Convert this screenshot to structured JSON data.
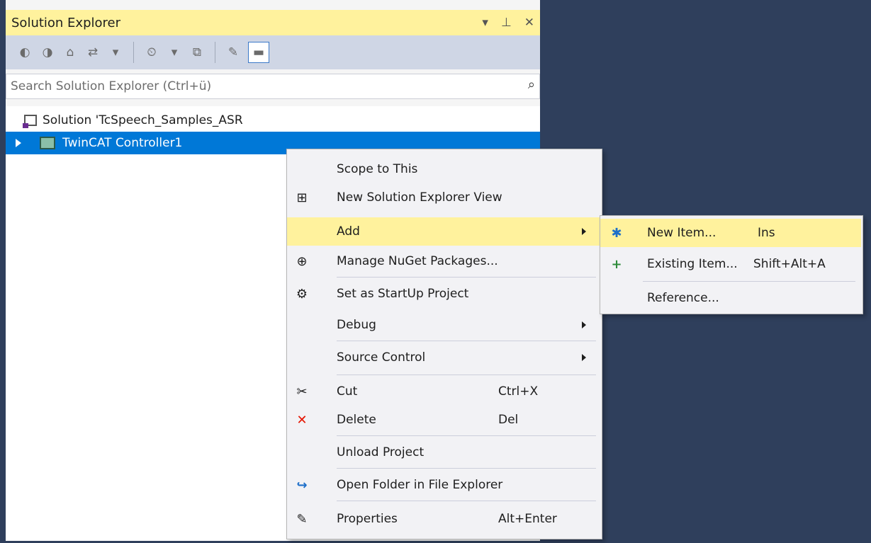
{
  "panel": {
    "title": "Solution Explorer",
    "title_icons": {
      "dropdown": "▾",
      "pin": "⊥",
      "close": "✕"
    }
  },
  "toolbar": {
    "back_icon": "◐",
    "forward_icon": "◑",
    "home_icon": "⌂",
    "sync_icon": "⇄",
    "pending_icon": "⏲",
    "collapse_icon": "⧉",
    "properties_icon": "✎",
    "preview_icon": "▬"
  },
  "search": {
    "placeholder": "Search Solution Explorer (Ctrl+ü)",
    "icon": "⌕"
  },
  "tree": {
    "solution_label": "Solution 'TcSpeech_Samples_ASR",
    "project_label": "TwinCAT Controller1"
  },
  "context_menu": {
    "items": [
      {
        "label": "Scope to This",
        "icon": "",
        "shortcut": ""
      },
      {
        "label": "New Solution Explorer View",
        "icon": "⊞",
        "shortcut": ""
      },
      {
        "label": "Add",
        "icon": "",
        "shortcut": ""
      },
      {
        "label": "Manage NuGet Packages...",
        "icon": "⊕",
        "shortcut": ""
      },
      {
        "label": "Set as StartUp Project",
        "icon": "⚙",
        "shortcut": ""
      },
      {
        "label": "Debug",
        "icon": "",
        "shortcut": ""
      },
      {
        "label": "Source Control",
        "icon": "",
        "shortcut": ""
      },
      {
        "label": "Cut",
        "icon": "✂",
        "shortcut": "Ctrl+X"
      },
      {
        "label": "Delete",
        "icon": "✕",
        "shortcut": "Del"
      },
      {
        "label": "Unload Project",
        "icon": "",
        "shortcut": ""
      },
      {
        "label": "Open Folder in File Explorer",
        "icon": "↪",
        "shortcut": ""
      },
      {
        "label": "Properties",
        "icon": "✎",
        "shortcut": "Alt+Enter"
      }
    ]
  },
  "submenu": {
    "items": [
      {
        "label": "New Item...",
        "shortcut": "Ins",
        "icon": "✱"
      },
      {
        "label": "Existing Item...",
        "shortcut": "Shift+Alt+A",
        "icon": "+"
      },
      {
        "label": "Reference...",
        "shortcut": "",
        "icon": ""
      }
    ]
  },
  "colors": {
    "highlight": "#fff29d",
    "selection": "#0078d7",
    "background": "#2f3f5c",
    "delete_red": "#e51400",
    "accent_blue": "#1e6fc9"
  }
}
